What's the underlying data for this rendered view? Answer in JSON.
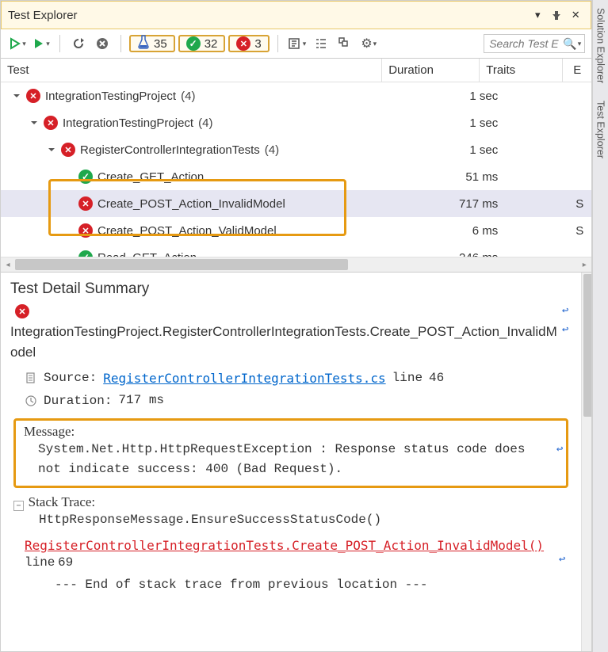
{
  "titlebar": {
    "title": "Test Explorer"
  },
  "toolbar": {
    "counts": {
      "total": "35",
      "passed": "32",
      "failed": "3"
    },
    "search_placeholder": "Search Test E"
  },
  "columns": {
    "test": "Test",
    "duration": "Duration",
    "traits": "Traits",
    "e": "E"
  },
  "tree": [
    {
      "level": 0,
      "status": "fail",
      "name": "IntegrationTestingProject",
      "count": "(4)",
      "duration": "1 sec",
      "expandable": true,
      "expanded": true
    },
    {
      "level": 1,
      "status": "fail",
      "name": "IntegrationTestingProject",
      "count": "(4)",
      "duration": "1 sec",
      "expandable": true,
      "expanded": true
    },
    {
      "level": 2,
      "status": "fail",
      "name": "RegisterControllerIntegrationTests",
      "count": "(4)",
      "duration": "1 sec",
      "expandable": true,
      "expanded": true
    },
    {
      "level": 3,
      "status": "pass",
      "name": "Create_GET_Action",
      "count": "",
      "duration": "51 ms",
      "expandable": false
    },
    {
      "level": 3,
      "status": "fail",
      "name": "Create_POST_Action_InvalidModel",
      "count": "",
      "duration": "717 ms",
      "expandable": false,
      "selected": true,
      "e": "S"
    },
    {
      "level": 3,
      "status": "fail",
      "name": "Create_POST_Action_ValidModel",
      "count": "",
      "duration": "6 ms",
      "expandable": false,
      "e": "S"
    },
    {
      "level": 3,
      "status": "pass",
      "name": "Read_GET_Action",
      "count": "",
      "duration": "246 ms",
      "expandable": false
    }
  ],
  "detail": {
    "heading": "Test Detail Summary",
    "status": "fail",
    "fqname": "IntegrationTestingProject.RegisterControllerIntegrationTests.Create_POST_Action_InvalidModel",
    "source_label": "Source:",
    "source_file": "RegisterControllerIntegrationTests.cs",
    "source_line_label": "line",
    "source_line_no": "46",
    "duration_label": "Duration:",
    "duration_value": "717 ms",
    "message_label": "Message:",
    "message_body": "System.Net.Http.HttpRequestException : Response status code does not indicate success: 400 (Bad Request).",
    "trace_label": "Stack Trace:",
    "trace_line1": "HttpResponseMessage.EnsureSuccessStatusCode()",
    "trace_method": "RegisterControllerIntegrationTests.Create_POST_Action_InvalidModel()",
    "trace_method_line_label": "line",
    "trace_method_line_no": "69",
    "trace_tail": "--- End of stack trace from previous location ---"
  },
  "side_tabs": {
    "solution": "Solution Explorer",
    "test": "Test Explorer"
  }
}
